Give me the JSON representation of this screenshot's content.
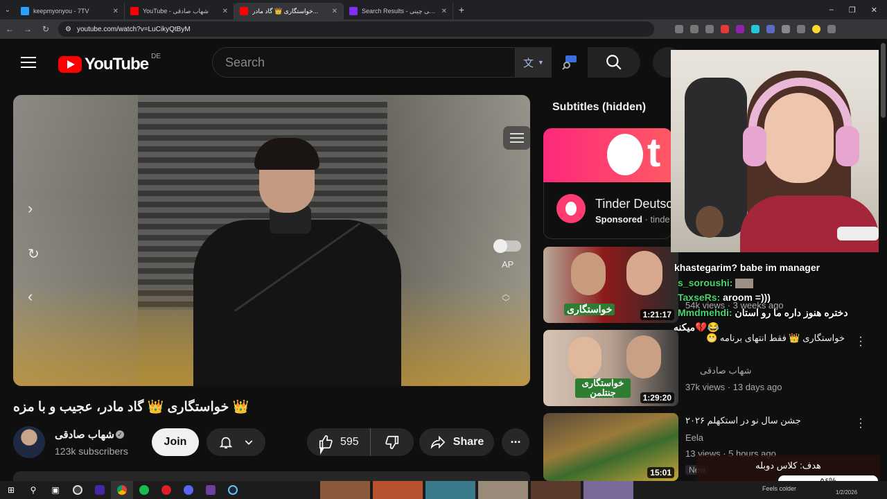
{
  "browser": {
    "tabs": [
      {
        "title": "keepmyonyou - 7TV",
        "favicon_color": "#29a3ff",
        "active": false
      },
      {
        "title": "YouTube - شهاب صادقی",
        "favicon_color": "#ff0000",
        "active": false
      },
      {
        "title": "خواستگاری 👑 گاد مادر...",
        "favicon_color": "#ff0000",
        "active": true
      },
      {
        "title": "Search Results - طالع بینی چینی",
        "favicon_color": "#7b2ff7",
        "active": false
      }
    ],
    "url": "youtube.com/watch?v=LuCikyQtByM",
    "window_controls": [
      "–",
      "❐",
      "✕"
    ]
  },
  "header": {
    "logo_text": "YouTube",
    "country_code": "DE",
    "search_placeholder": "Search"
  },
  "player": {
    "ap_label": "AP"
  },
  "video": {
    "title": "خواستگاری 👑 گاد مادر، عجیب و با مزه 👑",
    "channel_name": "شهاب صادقی",
    "subscribers": "123k subscribers",
    "join_label": "Join",
    "like_count": "595",
    "share_label": "Share"
  },
  "sidebar": {
    "subtitles_label": "Subtitles (hidden)",
    "ad": {
      "title": "Tinder Deutsc",
      "sponsored": "Sponsored",
      "advertiser": "tinde"
    },
    "videos": [
      {
        "duration": "1:21:17",
        "thumb_text": "خواستگاری",
        "meta": "54k views · 3 weeks ago"
      },
      {
        "duration": "1:29:20",
        "thumb_text": "خواستگاری جنتلمن",
        "title": "خواستگاری 👑 فقط انتهای برنامه 😬",
        "channel": "شهاب صادقی",
        "meta": "37k views · 13 days ago"
      },
      {
        "duration": "15:01",
        "title": "جشن سال نو در استکهلم ۲۰۲۶",
        "channel": "Eela",
        "meta": "13 views · 5 hours ago",
        "badge": "New"
      }
    ]
  },
  "chat": [
    {
      "text": "khastegarim? babe im manager"
    },
    {
      "name": "s_soroushi:",
      "text": ""
    },
    {
      "name": "TaxseRs:",
      "text": "aroom =)))"
    },
    {
      "name": "Mmdmehdi:",
      "text": "دختره هنوز داره ما رو استان"
    },
    {
      "text": "میکنه💔😂"
    }
  ],
  "goal": {
    "label": "هدف: کلاس دوبله",
    "progress_text": "۵۶%",
    "progress": 0.56
  },
  "taskbar": {
    "weather": "Feels colder",
    "date": "1/2/2026"
  }
}
